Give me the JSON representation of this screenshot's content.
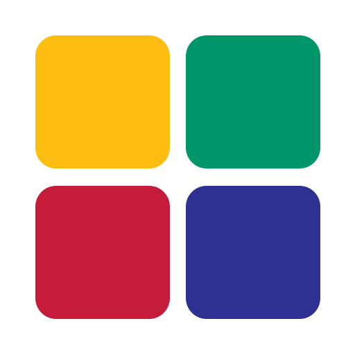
{
  "logo": {
    "tiles": [
      {
        "position": "top-left",
        "color": "#FDBE11"
      },
      {
        "position": "top-right",
        "color": "#00966A"
      },
      {
        "position": "bottom-left",
        "color": "#C41C3A"
      },
      {
        "position": "bottom-right",
        "color": "#2E3192"
      }
    ]
  }
}
